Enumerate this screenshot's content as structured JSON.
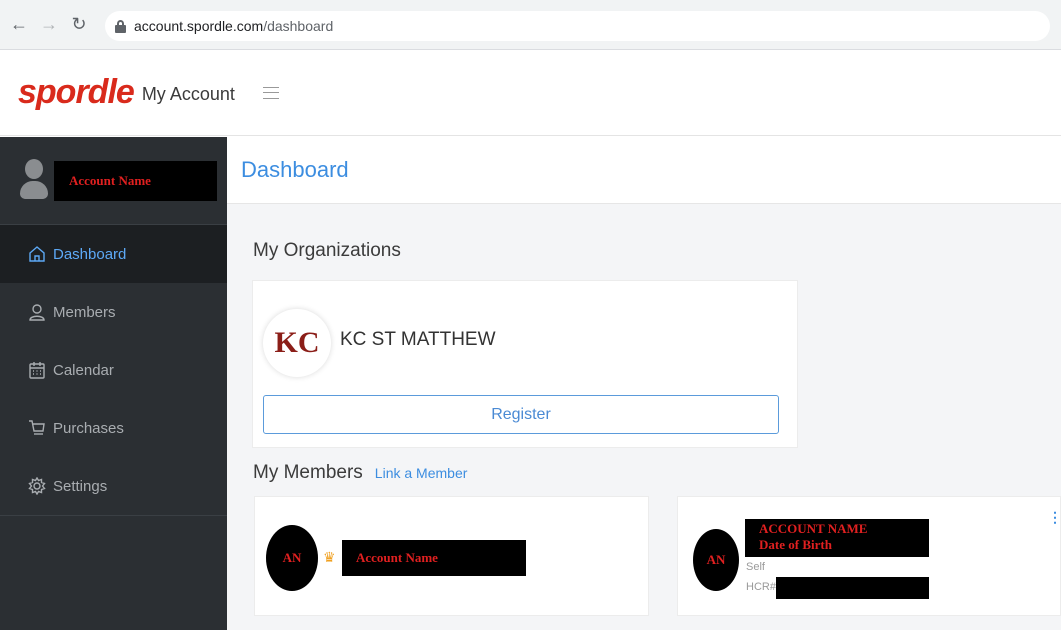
{
  "browser": {
    "url_host": "account.spordle.com",
    "url_path": "/dashboard"
  },
  "header": {
    "logo": "spordle",
    "app_name": "My Account"
  },
  "sidebar": {
    "account_name": "Account Name",
    "items": [
      {
        "label": "Dashboard",
        "icon": "home-icon"
      },
      {
        "label": "Members",
        "icon": "user-icon"
      },
      {
        "label": "Calendar",
        "icon": "calendar-icon"
      },
      {
        "label": "Purchases",
        "icon": "cart-icon"
      },
      {
        "label": "Settings",
        "icon": "gear-icon"
      }
    ]
  },
  "main": {
    "page_title": "Dashboard",
    "organizations_title": "My Organizations",
    "organization": {
      "logo_text": "KC",
      "name": "KC ST MATTHEW",
      "register_label": "Register"
    },
    "members_title": "My Members",
    "link_member_label": "Link a Member",
    "member_cards": [
      {
        "initials": "AN",
        "name": "Account Name"
      },
      {
        "initials": "AN",
        "name_line": "ACCOUNT NAME",
        "dob_line": "Date of Birth",
        "relation": "Self",
        "hcr_label": "HCR#"
      }
    ]
  },
  "colors": {
    "brand_red": "#d92a1c",
    "accent_blue": "#3c8de0",
    "sidebar_bg": "#2b2f33"
  }
}
